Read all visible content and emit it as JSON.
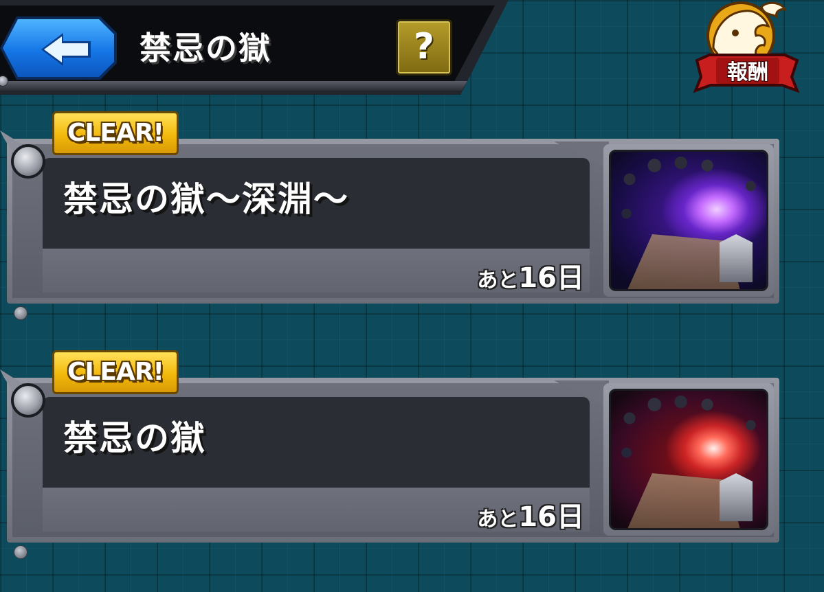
{
  "header": {
    "title": "禁忌の獄",
    "help_label": "?",
    "reward_label": "報酬"
  },
  "quests": [
    {
      "badge": "CLEAR!",
      "name": "禁忌の獄〜深淵〜",
      "remaining_prefix": "あと",
      "remaining_value": "16",
      "remaining_unit": "日",
      "thumbnail": "purple-cave"
    },
    {
      "badge": "CLEAR!",
      "name": "禁忌の獄",
      "remaining_prefix": "あと",
      "remaining_value": "16",
      "remaining_unit": "日",
      "thumbnail": "red-cave"
    }
  ],
  "colors": {
    "background": "#0d4a5c",
    "back_button": "#1576e6",
    "clear_badge": "#f3b90c",
    "help_button": "#9a821e",
    "reward_ribbon": "#c81e1e"
  },
  "icons": {
    "back": "back-arrow-icon",
    "help": "question-icon",
    "reward": "dragon-emblem-icon"
  }
}
